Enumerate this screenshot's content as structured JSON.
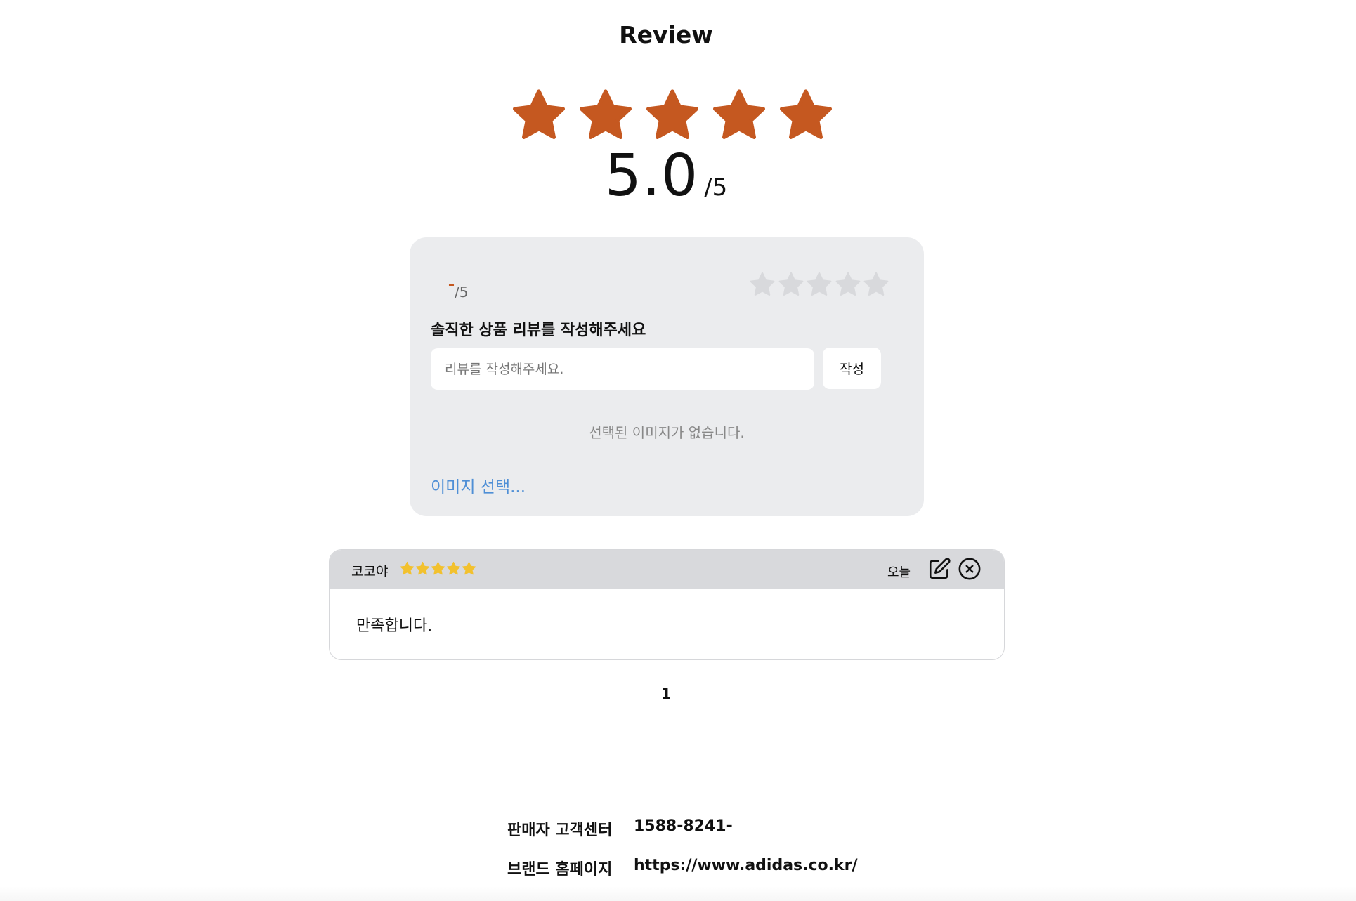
{
  "header": {
    "title": "Review"
  },
  "rating_summary": {
    "average": "5.0",
    "max_label": "/5",
    "star_fill": 5,
    "star_count": 5,
    "star_color": "#c55820"
  },
  "write_review": {
    "my_score_value": "–",
    "my_score_max": "/5",
    "star_fill": 0,
    "empty_star_color": "#d8d9dc",
    "prompt": "솔직한 상품 리뷰를 작성해주세요",
    "input_placeholder": "리뷰를 작성해주세요.",
    "input_value": "",
    "submit_label": "작성",
    "no_image_text": "선택된 이미지가 없습니다.",
    "pick_image_label": "이미지 선택..."
  },
  "reviews": [
    {
      "author": "코코야",
      "rating": 5,
      "star_color": "#f2c12e",
      "date": "오늘",
      "content": "만족합니다.",
      "edit_icon": "edit-icon",
      "delete_icon": "close-circle-icon"
    }
  ],
  "pagination": {
    "current": "1"
  },
  "footer": {
    "cs_label": "판매자 고객센터",
    "cs_value": "1588-8241-",
    "brand_label": "브랜드 홈페이지",
    "brand_value": "https://www.adidas.co.kr/"
  }
}
